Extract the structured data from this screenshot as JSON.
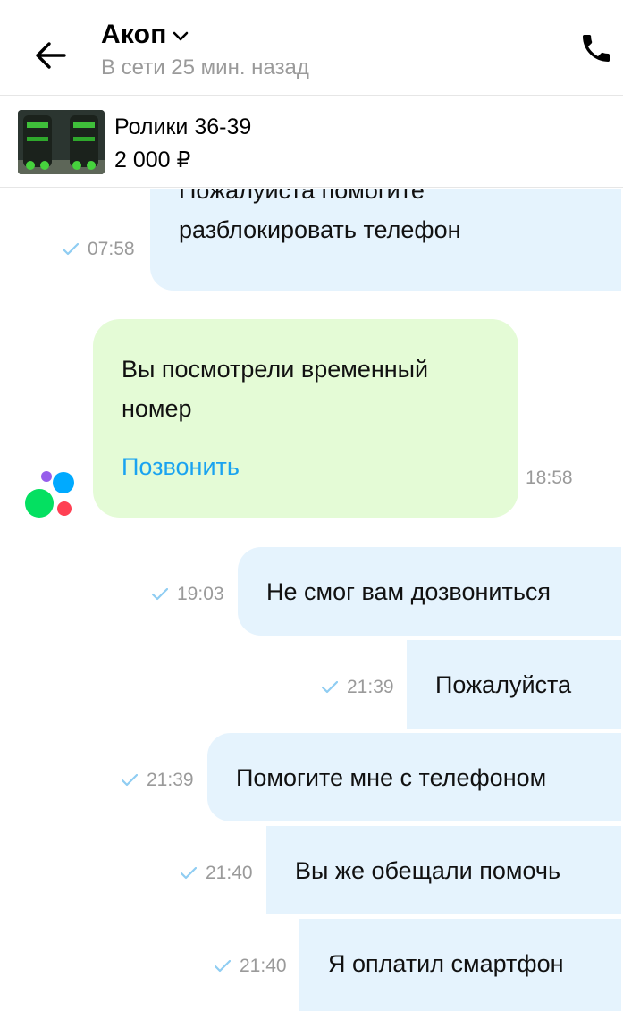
{
  "header": {
    "contact_name": "Акоп",
    "status": "В сети 25 мин. назад",
    "back_icon": "arrow-left-icon",
    "call_icon": "phone-icon"
  },
  "listing": {
    "title": "Ролики 36-39",
    "price": "2 000 ₽"
  },
  "messages": [
    {
      "type": "outgoing",
      "text_lines": [
        "Пожалуйста помогите",
        "разблокировать телефон"
      ],
      "time": "07:58",
      "status": "sent"
    },
    {
      "type": "system",
      "text": "Вы посмотрели временный номер",
      "link": "Позвонить",
      "time": "18:58"
    },
    {
      "type": "outgoing",
      "text": "Не смог вам дозвониться",
      "time": "19:03",
      "status": "sent"
    },
    {
      "type": "outgoing",
      "text": "Пожалуйста",
      "time": "21:39",
      "status": "sent"
    },
    {
      "type": "outgoing",
      "text": "Помогите мне с телефоном",
      "time": "21:39",
      "status": "sent"
    },
    {
      "type": "outgoing",
      "text": "Вы же обещали помочь",
      "time": "21:40",
      "status": "sent"
    },
    {
      "type": "outgoing",
      "text": "Я оплатил смартфон",
      "time": "21:40",
      "status": "sent"
    }
  ],
  "colors": {
    "outgoing_bubble": "#e5f3fd",
    "system_bubble": "#e4fbd6",
    "link": "#1aa3f0",
    "check": "#8fcdf2"
  }
}
